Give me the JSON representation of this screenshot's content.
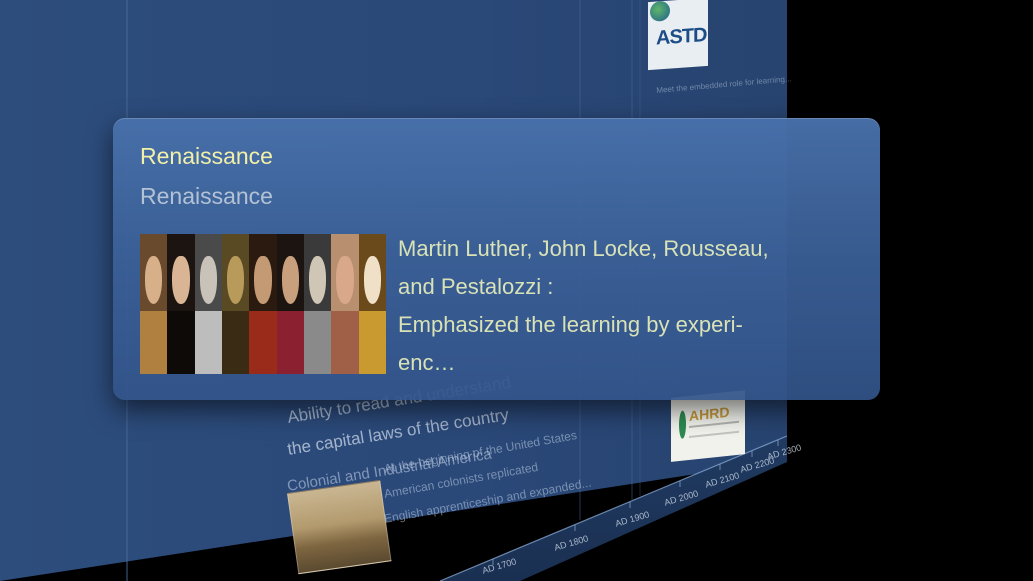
{
  "popup": {
    "title": "Renaissance",
    "subtitle": "Renaissance",
    "description_lines": [
      "Martin Luther, John Locke, Rousseau,",
      "and Pestalozzi :",
      "Emphasized the learning by experi-",
      "enc…"
    ],
    "portrait_count": 9
  },
  "background": {
    "headline_lines": [
      "Ability to read and understand",
      "the capital laws of the country"
    ],
    "era_label": "Colonial and Industrial America",
    "era_description": [
      "At the beginning of the United States",
      "American colonists replicated",
      "English apprenticeship and expanded..."
    ],
    "logos": [
      "ASTD",
      "AHRD"
    ],
    "astd_caption": "Meet the embedded role for learning...",
    "axis_labels": [
      "AD 1700",
      "AD 1800",
      "AD 1900",
      "AD 2000",
      "AD 2100",
      "AD 2200",
      "AD 2300"
    ]
  },
  "colors": {
    "title": "#f2f0a8",
    "subtitle": "#b3c2d4",
    "description": "#d8e2b6",
    "popup_bg": "#4870aa",
    "wall_bg": "#2b4a78"
  }
}
